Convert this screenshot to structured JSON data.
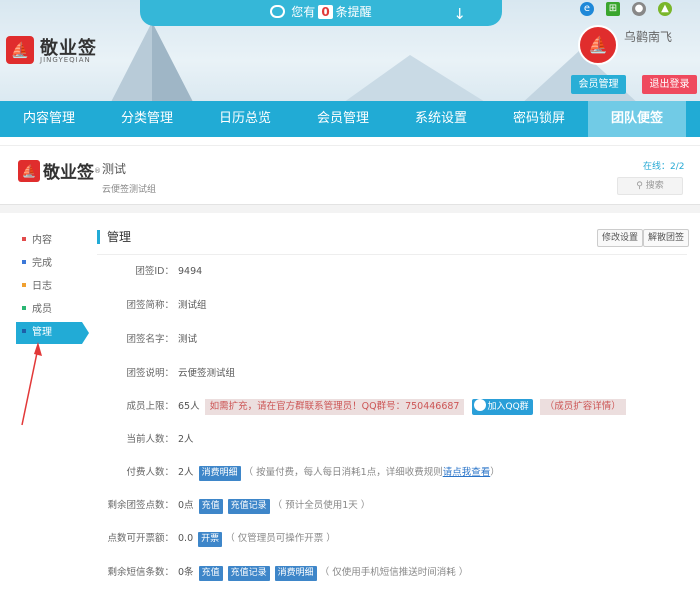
{
  "header": {
    "notice_prefix": "您有",
    "notice_count": "0",
    "notice_suffix": "条提醒",
    "logo_title": "敬业签",
    "logo_sub": "JINGYEQIAN",
    "user_name": "乌鹳南飞",
    "member_btn": "会员管理",
    "logout_btn": "退出登录",
    "platforms": [
      "ie-icon",
      "windows-icon",
      "apple-icon",
      "android-icon"
    ]
  },
  "nav": {
    "items": [
      "内容管理",
      "分类管理",
      "日历总览",
      "会员管理",
      "系统设置",
      "密码锁屏",
      "团队便签"
    ],
    "active_index": 6
  },
  "group": {
    "logo_text": "敬业签",
    "name": "测试",
    "desc": "云便签测试组",
    "online_label": "在线：",
    "online_value": "2/2",
    "search_placeholder": "搜索"
  },
  "sidebar": {
    "items": [
      {
        "label": "内容",
        "color": "#e24b4b"
      },
      {
        "label": "完成",
        "color": "#3c78d8"
      },
      {
        "label": "日志",
        "color": "#f0a030"
      },
      {
        "label": "成员",
        "color": "#2bb673"
      },
      {
        "label": "管理",
        "color": "#1d5fa8"
      }
    ],
    "active_index": 4
  },
  "main": {
    "title": "管理",
    "edit_btn": "修改设置",
    "dissolve_btn": "解散团签",
    "rows": {
      "id": {
        "label": "团签ID：",
        "value": "9494"
      },
      "short": {
        "label": "团签简称：",
        "value": "测试组"
      },
      "name": {
        "label": "团签名字：",
        "value": "测试"
      },
      "desc": {
        "label": "团签说明：",
        "value": "云便签测试组"
      },
      "limit": {
        "label": "成员上限：",
        "value": "65人",
        "alert": "如需扩充，请在官方群联系管理员！QQ群号：750446687",
        "qq_btn": "加入QQ群",
        "expand": "（成员扩容详情）"
      },
      "current": {
        "label": "当前人数：",
        "value": "2人"
      },
      "paid": {
        "label": "付费人数：",
        "value": "2人",
        "tag": "消费明细",
        "hint_pre": "（ 按量付费，每人每日消耗1点，详细收费规则",
        "link": "请点我查看",
        "hint_post": "）"
      },
      "points": {
        "label": "剩余团签点数：",
        "value": "0点",
        "tag1": "充值",
        "tag2": "充值记录",
        "hint": "（ 预计全员使用1天 ）"
      },
      "invoice": {
        "label": "点数可开票额：",
        "value": "0.0",
        "tag": "开票",
        "hint": "（ 仅管理员可操作开票 ）"
      },
      "sms": {
        "label": "剩余短信条数：",
        "value": "0条",
        "tag1": "充值",
        "tag2": "充值记录",
        "tag3": "消费明细",
        "hint": "（ 仅使用手机短信推送时间消耗 ）"
      }
    }
  }
}
